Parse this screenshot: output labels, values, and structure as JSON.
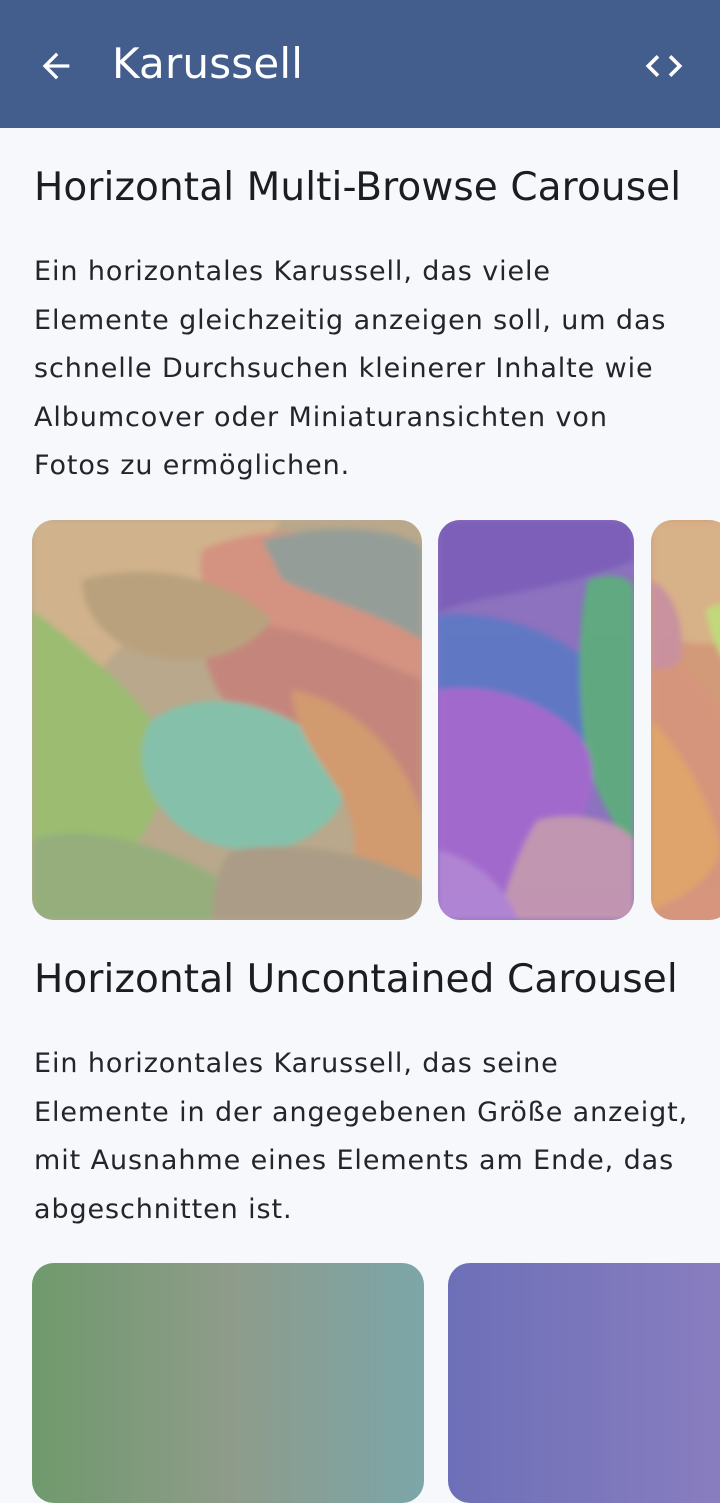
{
  "appbar": {
    "title": "Karussell",
    "back_icon": "arrow-back-icon",
    "code_icon": "code-icon",
    "background": "#435e8c"
  },
  "sections": [
    {
      "title": "Horizontal Multi-Browse Carousel",
      "description": "Ein horizontales Karussell, das viele Elemente gleichzeitig anzeigen soll, um das schnelle Durchsuchen kleinerer Inhalte wie Albumcover oder Miniaturansichten von Fotos zu ermöglichen."
    },
    {
      "title": "Horizontal Uncontained Carousel",
      "description": "Ein horizontales Karussell, das seine Elemente in der angegebenen Größe anzeigt, mit Ausnahme eines Elements am Ende, das abgeschnitten ist."
    }
  ]
}
